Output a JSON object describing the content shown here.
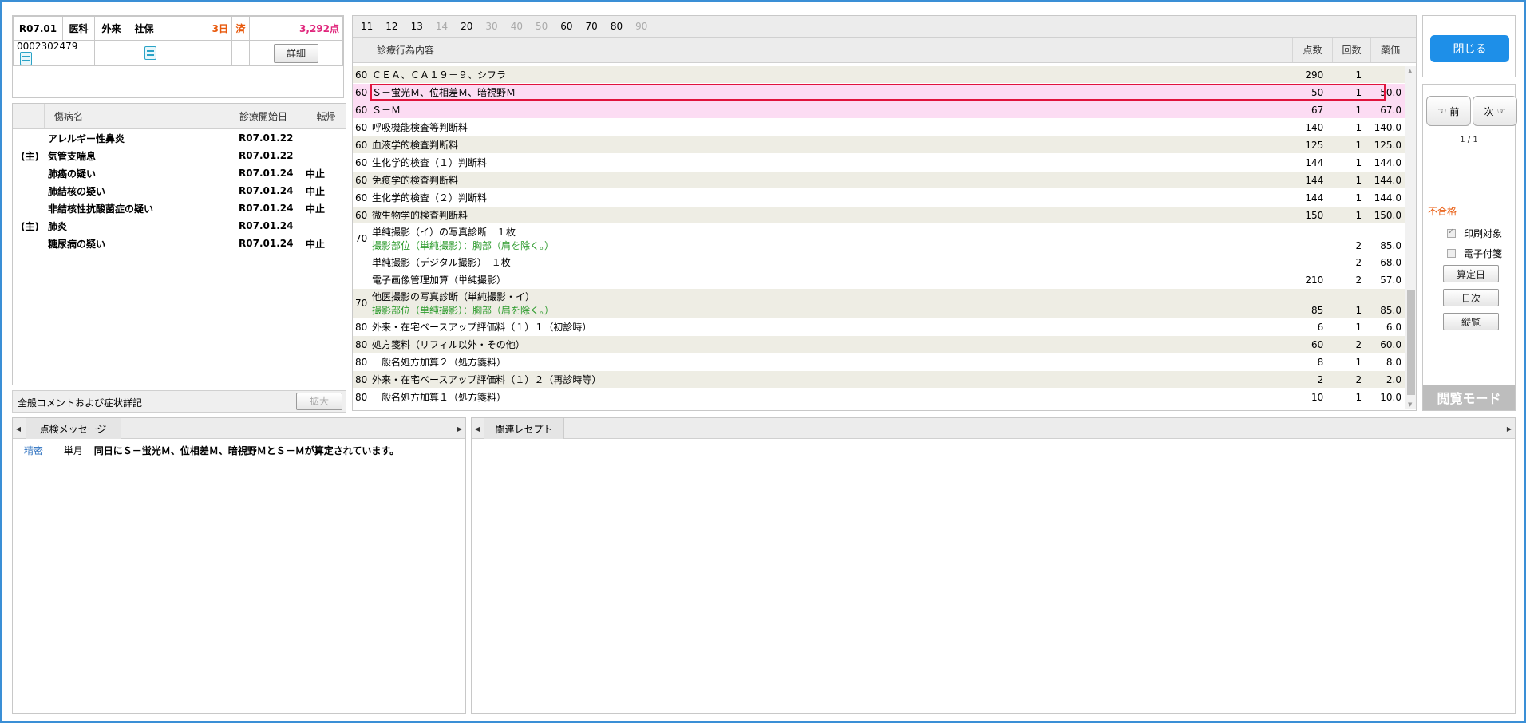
{
  "header": {
    "era": "R07.01",
    "dept": "医科",
    "visit_type": "外来",
    "insurance": "社保",
    "days": "3日",
    "status": "済",
    "points": "3,292点",
    "patient_id": "0002302479",
    "detail_button": "詳細"
  },
  "disease_list": {
    "columns": [
      "傷病名",
      "診療開始日",
      "転帰"
    ],
    "rows": [
      {
        "prefix": "",
        "name": "アレルギー性鼻炎",
        "date": "R07.01.22",
        "outcome": ""
      },
      {
        "prefix": "(主)",
        "name": "気管支喘息",
        "date": "R07.01.22",
        "outcome": ""
      },
      {
        "prefix": "",
        "name": "肺癌の疑い",
        "date": "R07.01.24",
        "outcome": "中止"
      },
      {
        "prefix": "",
        "name": "肺結核の疑い",
        "date": "R07.01.24",
        "outcome": "中止"
      },
      {
        "prefix": "",
        "name": "非結核性抗酸菌症の疑い",
        "date": "R07.01.24",
        "outcome": "中止"
      },
      {
        "prefix": "(主)",
        "name": "肺炎",
        "date": "R07.01.24",
        "outcome": ""
      },
      {
        "prefix": "",
        "name": "糖尿病の疑い",
        "date": "R07.01.24",
        "outcome": "中止"
      }
    ]
  },
  "comment_bar": {
    "label": "全般コメントおよび症状詳記",
    "expand_button": "拡大"
  },
  "category_tabs": [
    "11",
    "12",
    "13",
    "14",
    "20",
    "30",
    "40",
    "50",
    "60",
    "70",
    "80",
    "90"
  ],
  "category_tabs_disabled": [
    "14",
    "30",
    "40",
    "50",
    "90"
  ],
  "main_table": {
    "columns": [
      "診療行為内容",
      "点数",
      "回数",
      "薬価"
    ],
    "rows": [
      {
        "code": "60",
        "lines": [
          "ＣＥＡ、ＣＡ１９－９、シフラ"
        ],
        "points": "290",
        "count": "1",
        "price": "",
        "bg": "a"
      },
      {
        "code": "60",
        "lines": [
          "Ｓ－蛍光Ｍ、位相差Ｍ、暗視野Ｍ"
        ],
        "points": "50",
        "count": "1",
        "price": "50.0",
        "bg": "pink",
        "selected": true
      },
      {
        "code": "60",
        "lines": [
          "Ｓ－Ｍ"
        ],
        "points": "67",
        "count": "1",
        "price": "67.0",
        "bg": "pink"
      },
      {
        "code": "60",
        "lines": [
          "呼吸機能検査等判断料"
        ],
        "points": "140",
        "count": "1",
        "price": "140.0",
        "bg": "b"
      },
      {
        "code": "60",
        "lines": [
          "血液学的検査判断料"
        ],
        "points": "125",
        "count": "1",
        "price": "125.0",
        "bg": "a"
      },
      {
        "code": "60",
        "lines": [
          "生化学的検査（１）判断料"
        ],
        "points": "144",
        "count": "1",
        "price": "144.0",
        "bg": "b"
      },
      {
        "code": "60",
        "lines": [
          "免疫学的検査判断料"
        ],
        "points": "144",
        "count": "1",
        "price": "144.0",
        "bg": "a"
      },
      {
        "code": "60",
        "lines": [
          "生化学的検査（２）判断料"
        ],
        "points": "144",
        "count": "1",
        "price": "144.0",
        "bg": "b"
      },
      {
        "code": "60",
        "lines": [
          "微生物学的検査判断料"
        ],
        "points": "150",
        "count": "1",
        "price": "150.0",
        "bg": "a"
      },
      {
        "code": "70",
        "lines": [
          "単純撮影（イ）の写真診断　１枚",
          "撮影部位（単純撮影）：胸部（肩を除く。）"
        ],
        "points": "",
        "count": "2",
        "price": "85.0",
        "bg": "b"
      },
      {
        "code": "",
        "lines": [
          "単純撮影（デジタル撮影）　１枚"
        ],
        "points": "",
        "count": "2",
        "price": "68.0",
        "bg": "b"
      },
      {
        "code": "",
        "lines": [
          "電子画像管理加算（単純撮影）"
        ],
        "points": "210",
        "count": "2",
        "price": "57.0",
        "bg": "b"
      },
      {
        "code": "70",
        "lines": [
          "他医撮影の写真診断（単純撮影・イ）",
          "撮影部位（単純撮影）：胸部（肩を除く。）"
        ],
        "points": "85",
        "count": "1",
        "price": "85.0",
        "bg": "a"
      },
      {
        "code": "80",
        "lines": [
          "外来・在宅ベースアップ評価料（１）１（初診時）"
        ],
        "points": "6",
        "count": "1",
        "price": "6.0",
        "bg": "b"
      },
      {
        "code": "80",
        "lines": [
          "処方箋料（リフィル以外・その他）"
        ],
        "points": "60",
        "count": "2",
        "price": "60.0",
        "bg": "a"
      },
      {
        "code": "80",
        "lines": [
          "一般名処方加算２（処方箋料）"
        ],
        "points": "8",
        "count": "1",
        "price": "8.0",
        "bg": "b"
      },
      {
        "code": "80",
        "lines": [
          "外来・在宅ベースアップ評価料（１）２（再診時等）"
        ],
        "points": "2",
        "count": "2",
        "price": "2.0",
        "bg": "a"
      },
      {
        "code": "80",
        "lines": [
          "一般名処方加算１（処方箋料）"
        ],
        "points": "10",
        "count": "1",
        "price": "10.0",
        "bg": "b"
      }
    ]
  },
  "right_panel": {
    "close_button": "閉じる",
    "prev_button": "前",
    "next_button": "次",
    "page_indicator": "1 / 1",
    "fail_label": "不合格",
    "print_target": "印刷対象",
    "e_attach": "電子付箋",
    "calc_date_button": "算定日",
    "daily_button": "日次",
    "vertical_button": "縦覧",
    "mode_label": "閲覧モード"
  },
  "check_panel": {
    "tab": "点検メッセージ",
    "message": {
      "level": "精密",
      "period": "単月",
      "text": "同日にＳ－蛍光Ｍ、位相差Ｍ、暗視野ＭとＳ－Ｍが算定されています。"
    }
  },
  "related_panel": {
    "tab": "関連レセプト"
  },
  "colors": {
    "accent": "#1e8fe8",
    "selected_row_border": "#e0143c",
    "highlight_row": "#fcdcf3",
    "alt_row": "#eeede4",
    "points_text": "#e0287d",
    "days_text": "#e8590c",
    "fail_text": "#e8590c",
    "body_part_text": "#2d9b2d"
  }
}
